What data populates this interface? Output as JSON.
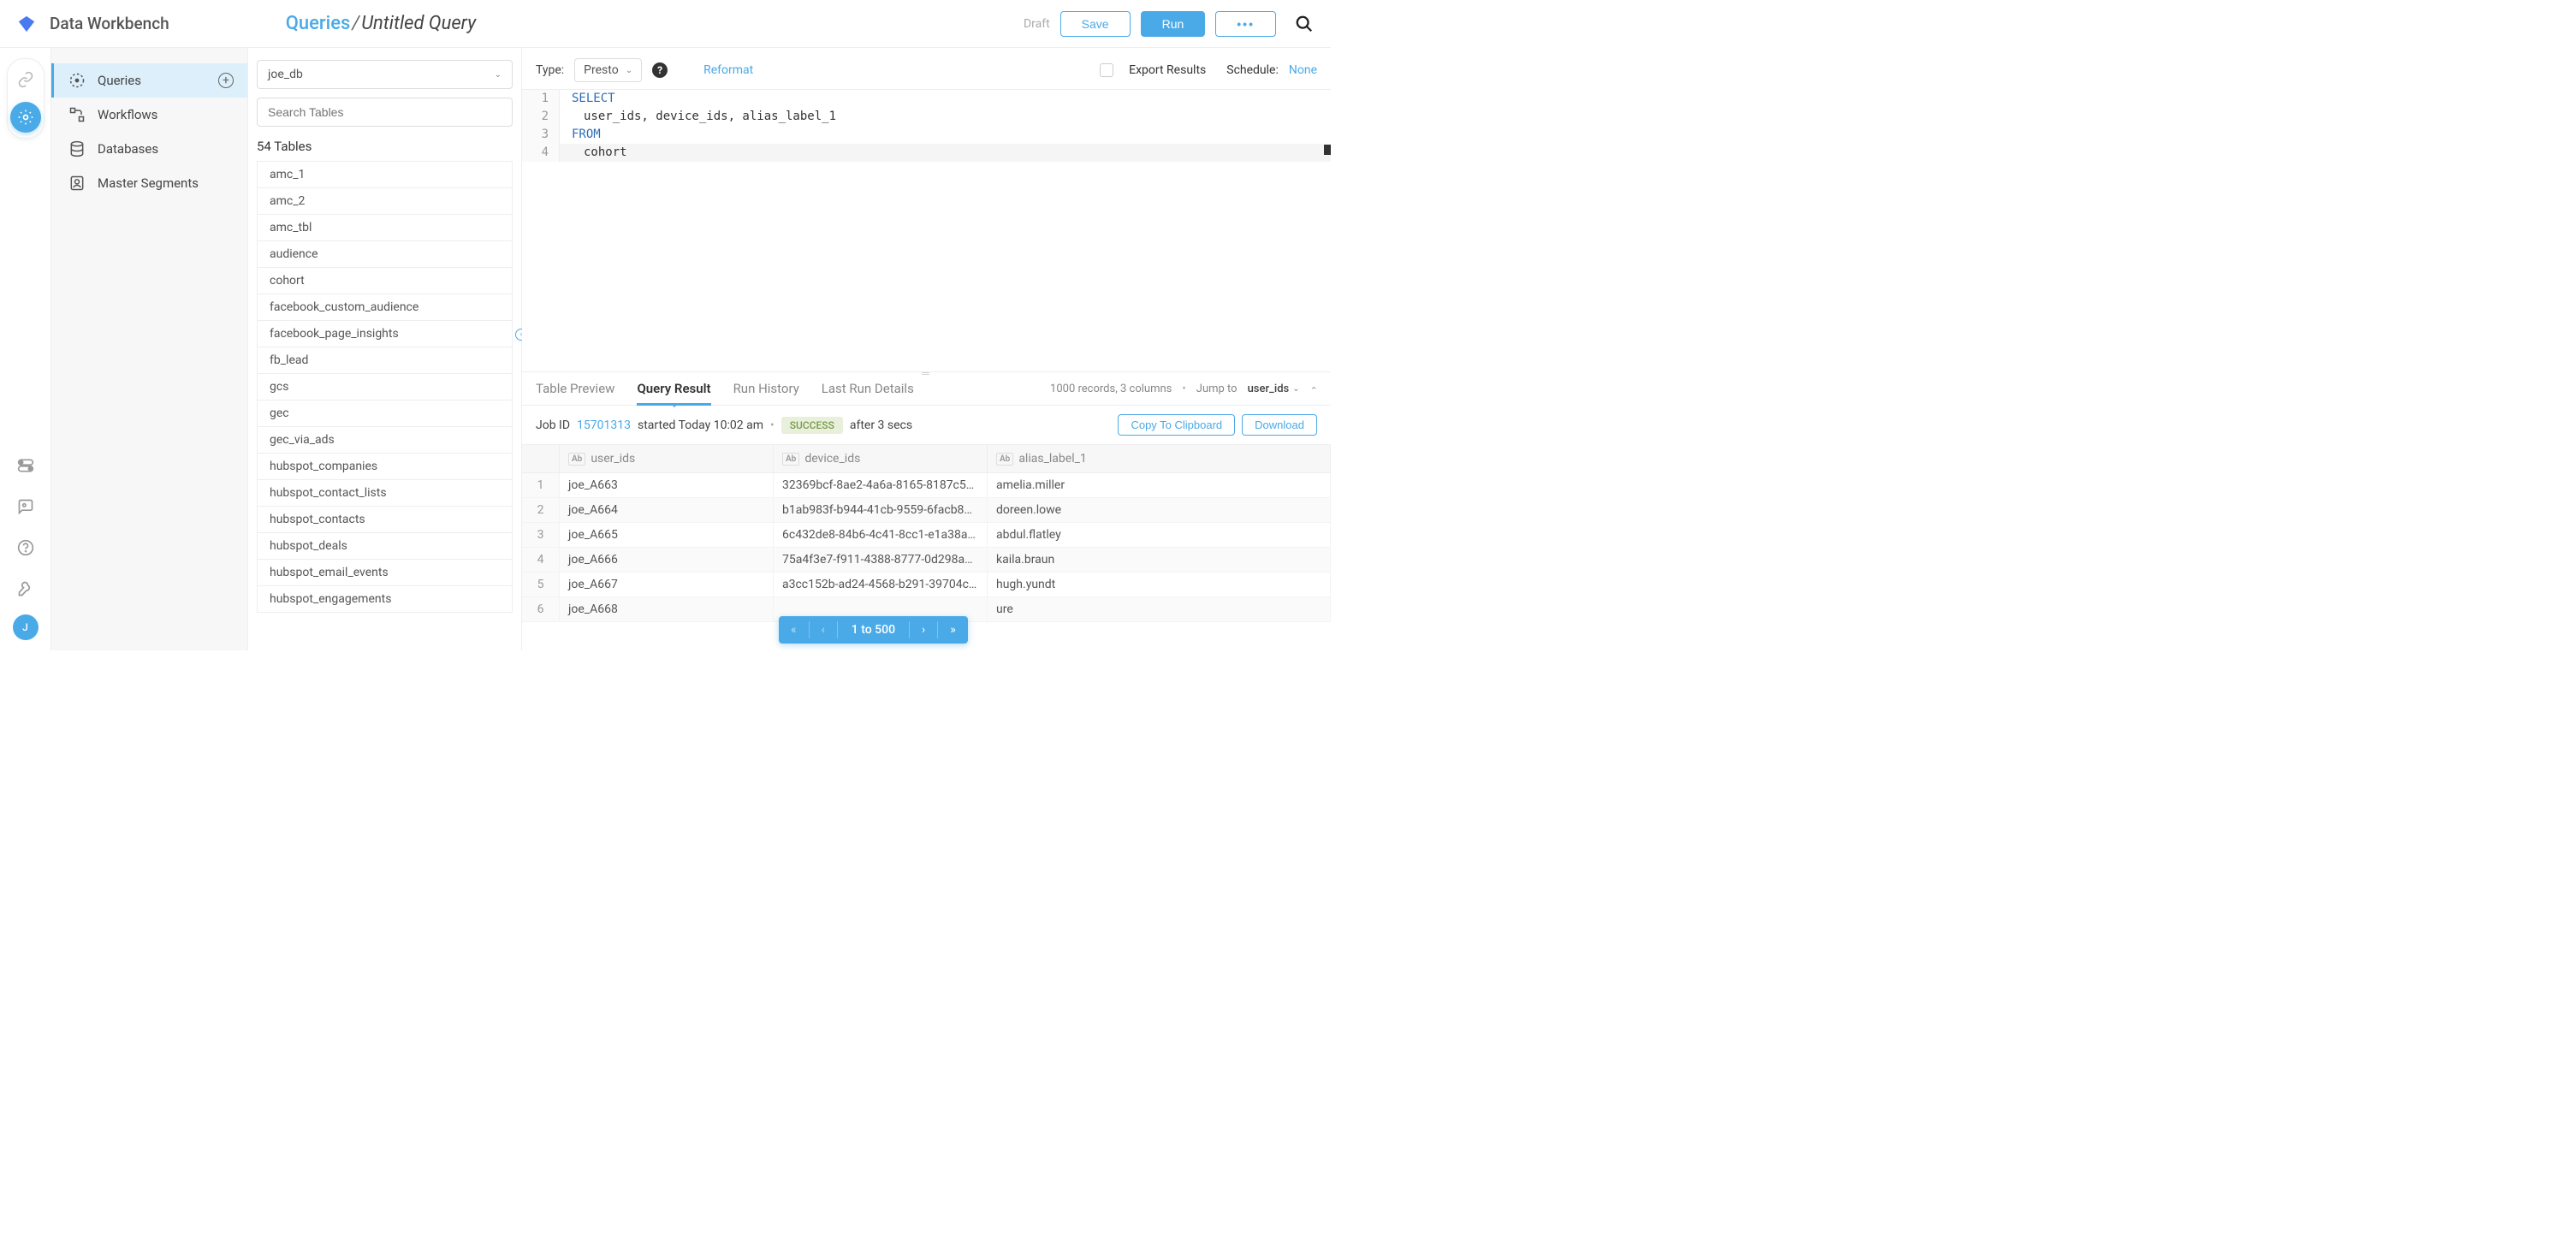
{
  "app_title": "Data Workbench",
  "breadcrumb": {
    "root": "Queries",
    "sep": "/",
    "current": "Untitled Query"
  },
  "header_actions": {
    "draft": "Draft",
    "save": "Save",
    "run": "Run",
    "more": "•••"
  },
  "nav": {
    "items": [
      {
        "label": "Queries",
        "active": true,
        "has_add": true
      },
      {
        "label": "Workflows"
      },
      {
        "label": "Databases"
      },
      {
        "label": "Master Segments"
      }
    ]
  },
  "avatar_initial": "J",
  "db_select": {
    "value": "joe_db"
  },
  "search_tables": {
    "placeholder": "Search Tables"
  },
  "tables_count": "54 Tables",
  "tables": [
    "amc_1",
    "amc_2",
    "amc_tbl",
    "audience",
    "cohort",
    "facebook_custom_audience",
    "facebook_page_insights",
    "fb_lead",
    "gcs",
    "gec",
    "gec_via_ads",
    "hubspot_companies",
    "hubspot_contact_lists",
    "hubspot_contacts",
    "hubspot_deals",
    "hubspot_email_events",
    "hubspot_engagements"
  ],
  "editor_toolbar": {
    "type_label": "Type:",
    "type_value": "Presto",
    "reformat": "Reformat",
    "export_label": "Export Results",
    "schedule_label": "Schedule:",
    "schedule_value": "None"
  },
  "code": {
    "lines": [
      {
        "n": "1",
        "kw": "SELECT",
        "rest": ""
      },
      {
        "n": "2",
        "kw": "",
        "rest": "user_ids, device_ids, alias_label_1",
        "indent": true
      },
      {
        "n": "3",
        "kw": "FROM",
        "rest": ""
      },
      {
        "n": "4",
        "kw": "",
        "rest": "cohort",
        "indent": true,
        "highlight": true
      }
    ]
  },
  "results": {
    "tabs": [
      {
        "label": "Table Preview"
      },
      {
        "label": "Query Result",
        "active": true
      },
      {
        "label": "Run History"
      },
      {
        "label": "Last Run Details"
      }
    ],
    "meta": "1000 records, 3 columns",
    "jump_label": "Jump to",
    "jump_value": "user_ids",
    "job": {
      "label": "Job ID",
      "id": "15701313",
      "started": "started Today 10:02 am",
      "status": "SUCCESS",
      "after": "after 3 secs",
      "copy": "Copy To Clipboard",
      "download": "Download"
    },
    "columns": [
      "user_ids",
      "device_ids",
      "alias_label_1"
    ],
    "col_type": "Ab",
    "rows": [
      {
        "i": "1",
        "user_ids": "joe_A663",
        "device_ids": "32369bcf-8ae2-4a6a-8165-8187c5…",
        "alias_label_1": "amelia.miller"
      },
      {
        "i": "2",
        "user_ids": "joe_A664",
        "device_ids": "b1ab983f-b944-41cb-9559-6facb84…",
        "alias_label_1": "doreen.lowe"
      },
      {
        "i": "3",
        "user_ids": "joe_A665",
        "device_ids": "6c432de8-84b6-4c41-8cc1-e1a38a…",
        "alias_label_1": "abdul.flatley"
      },
      {
        "i": "4",
        "user_ids": "joe_A666",
        "device_ids": "75a4f3e7-f911-4388-8777-0d298a…",
        "alias_label_1": "kaila.braun"
      },
      {
        "i": "5",
        "user_ids": "joe_A667",
        "device_ids": "a3cc152b-ad24-4568-b291-39704c…",
        "alias_label_1": "hugh.yundt"
      },
      {
        "i": "6",
        "user_ids": "joe_A668",
        "device_ids": "",
        "alias_label_1": "ure"
      }
    ],
    "paginator": "1 to 500"
  }
}
